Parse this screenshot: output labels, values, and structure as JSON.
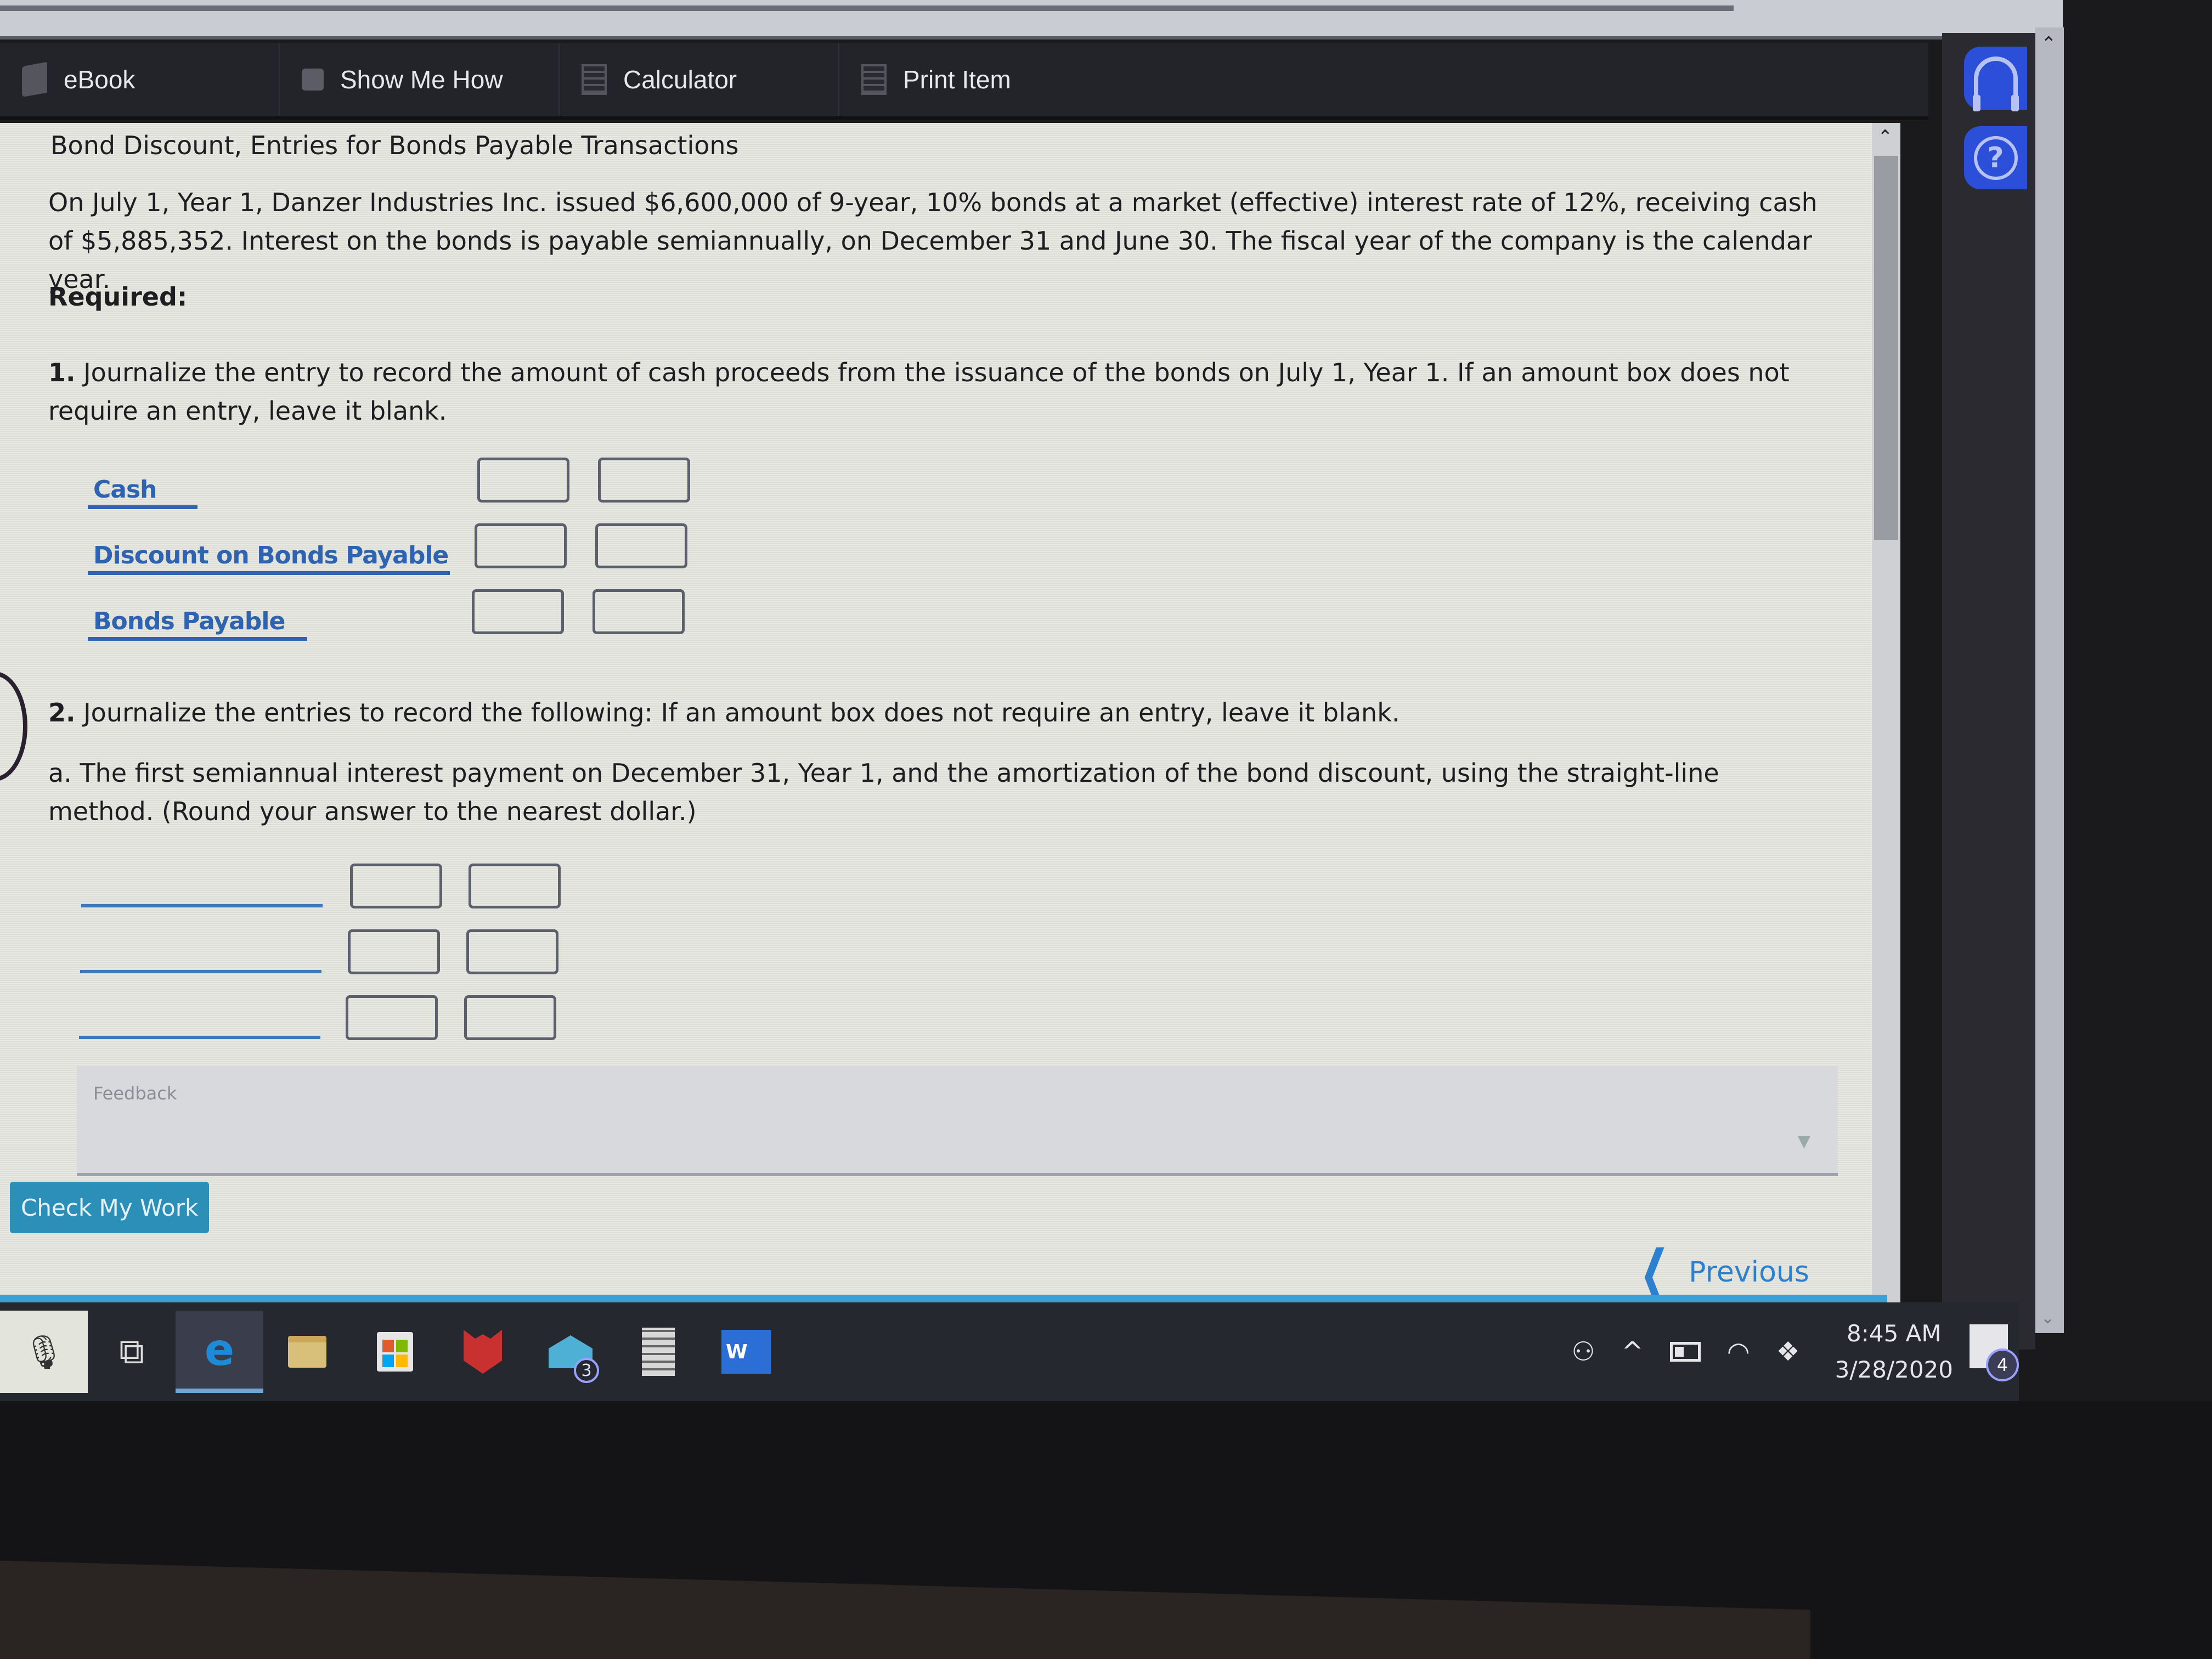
{
  "toolbar": {
    "items": [
      {
        "label": "eBook",
        "icon": "book-icon"
      },
      {
        "label": "Show Me How",
        "icon": "video-icon"
      },
      {
        "label": "Calculator",
        "icon": "calculator-icon"
      },
      {
        "label": "Print Item",
        "icon": "print-icon"
      }
    ]
  },
  "side_panel": {
    "support_icon": "headset-icon",
    "help_icon": "help-icon",
    "help_glyph": "?"
  },
  "problem": {
    "title": "Bond Discount, Entries for Bonds Payable Transactions",
    "intro": "On July 1, Year 1, Danzer Industries Inc. issued $6,600,000 of 9-year, 10% bonds at a market (effective) interest rate of 12%, receiving cash of $5,885,352. Interest on the bonds is payable semiannually, on December 31 and June 30. The fiscal year of the company is the calendar year.",
    "required_label": "Required:",
    "q1": {
      "number": "1.",
      "text": "Journalize the entry to record the amount of cash proceeds from the issuance of the bonds on July 1, Year 1. If an amount box does not require an entry, leave it blank.",
      "rows": [
        {
          "account": "Cash",
          "debit": "",
          "credit": ""
        },
        {
          "account": "Discount on Bonds Payable",
          "debit": "",
          "credit": ""
        },
        {
          "account": "Bonds Payable",
          "debit": "",
          "credit": ""
        }
      ]
    },
    "q2": {
      "number": "2.",
      "text": "Journalize the entries to record the following: If an amount box does not require an entry, leave it blank.",
      "a": {
        "letter": "a.",
        "text": "The first semiannual interest payment on December 31, Year 1, and the amortization of the bond discount, using the straight-line method. (Round your answer to the nearest dollar.)",
        "rows": [
          {
            "account": "",
            "debit": "",
            "credit": ""
          },
          {
            "account": "",
            "debit": "",
            "credit": ""
          },
          {
            "account": "",
            "debit": "",
            "credit": ""
          }
        ]
      }
    },
    "feedback_label": "Feedback"
  },
  "actions": {
    "check_my_work": "Check My Work",
    "previous": "Previous"
  },
  "taskbar": {
    "apps": [
      {
        "name": "microphone",
        "glyph": "🎙"
      },
      {
        "name": "task-view",
        "glyph": "⧉"
      },
      {
        "name": "edge",
        "glyph": "e"
      },
      {
        "name": "file-explorer"
      },
      {
        "name": "store"
      },
      {
        "name": "mcafee"
      },
      {
        "name": "mail",
        "badge": "3"
      },
      {
        "name": "calculator"
      },
      {
        "name": "word",
        "glyph": "W"
      }
    ],
    "tray": {
      "people_icon": "people-icon",
      "chevron": "^",
      "time": "8:45 AM",
      "date": "3/28/2020",
      "notification_count": "4"
    }
  }
}
